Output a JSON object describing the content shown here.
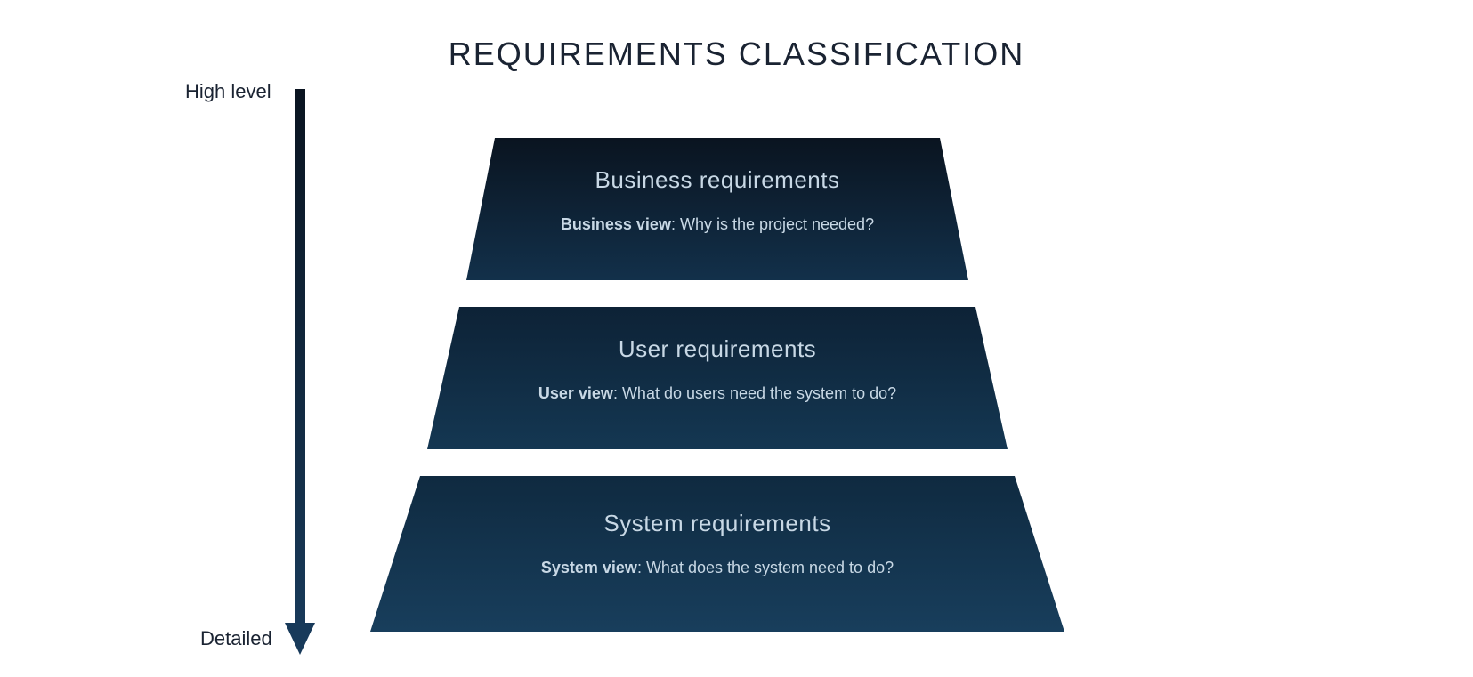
{
  "title": "REQUIREMENTS CLASSIFICATION",
  "axis": {
    "top": "High level",
    "bottom": "Detailed"
  },
  "levels": [
    {
      "title": "Business requirements",
      "view_label": "Business view",
      "question": ": Why is the project needed?"
    },
    {
      "title": "User requirements",
      "view_label": "User view",
      "question": ": What do users need the system to do?"
    },
    {
      "title": "System requirements",
      "view_label": "System view",
      "question": ": What does the system need to do?"
    }
  ],
  "colors": {
    "bg": "#ffffff",
    "text_dark": "#1a2332",
    "shape_top": "#0a1420",
    "shape_mid": "#10314c",
    "shape_bottom": "#183a5a",
    "text_light": "#c8d8e5"
  }
}
